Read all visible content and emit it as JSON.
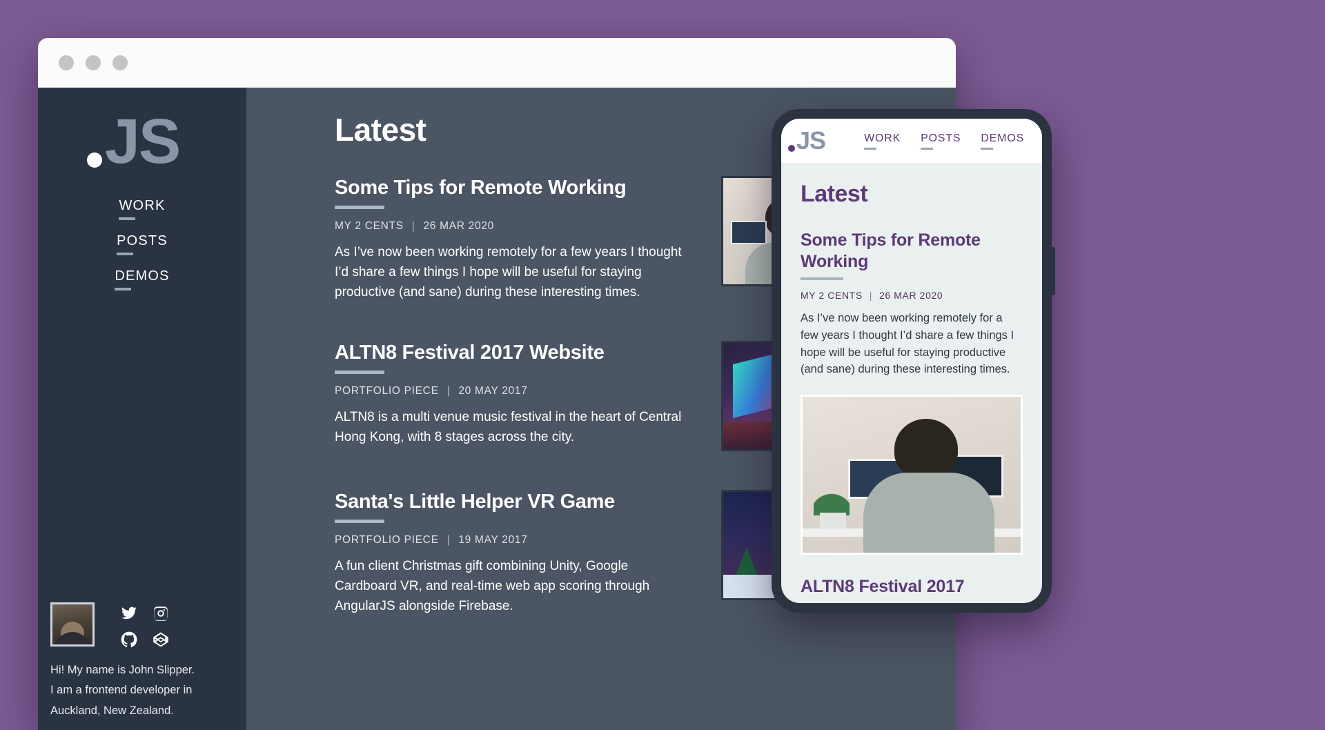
{
  "browser": {
    "traffic_lights": [
      "close",
      "minimize",
      "maximize"
    ]
  },
  "sidebar": {
    "logo": "JS",
    "nav": [
      {
        "label": "WORK"
      },
      {
        "label": "POSTS"
      },
      {
        "label": "DEMOS"
      }
    ],
    "socials": [
      {
        "name": "twitter-icon"
      },
      {
        "name": "instagram-icon"
      },
      {
        "name": "github-icon"
      },
      {
        "name": "codepen-icon"
      }
    ],
    "bio_line1": "Hi! My name is John Slipper.",
    "bio_line2": "I am a frontend developer in",
    "bio_line3": "Auckland, New Zealand."
  },
  "main": {
    "title": "Latest",
    "posts": [
      {
        "title": "Some Tips for Remote Working",
        "category": "MY 2 CENTS",
        "date": "26 MAR 2020",
        "excerpt": "As I’ve now been working remotely for a few years I thought I’d share a few things I hope will be useful for staying productive (and sane) during these interesting times."
      },
      {
        "title": "ALTN8 Festival 2017 Website",
        "category": "PORTFOLIO PIECE",
        "date": "20 MAY 2017",
        "excerpt": "ALTN8 is a multi venue music festival in the heart of Central Hong Kong, with 8 stages across the city."
      },
      {
        "title": "Santa's Little Helper VR Game",
        "category": "PORTFOLIO PIECE",
        "date": "19 MAY 2017",
        "excerpt": "A fun client Christmas gift combining Unity, Google Cardboard VR, and real-time web app scoring through AngularJS alongside Firebase."
      }
    ]
  },
  "phone": {
    "logo": "JS",
    "nav": [
      {
        "label": "WORK"
      },
      {
        "label": "POSTS"
      },
      {
        "label": "DEMOS"
      }
    ],
    "title": "Latest",
    "post": {
      "title": "Some Tips for Remote Working",
      "category": "MY 2 CENTS",
      "date": "26 MAR 2020",
      "excerpt": "As I’ve now been working remotely for a few years I thought I’d share a few things I hope will be useful for staying productive (and sane) during these interesting times."
    },
    "next_post_title": "ALTN8 Festival 2017"
  },
  "colors": {
    "background": "#7c5a93",
    "sidebar": "#2a3342",
    "content": "#4b5563",
    "accent_purple": "#5d3a77",
    "logo_grey": "#8b95a8"
  },
  "separator": "|"
}
